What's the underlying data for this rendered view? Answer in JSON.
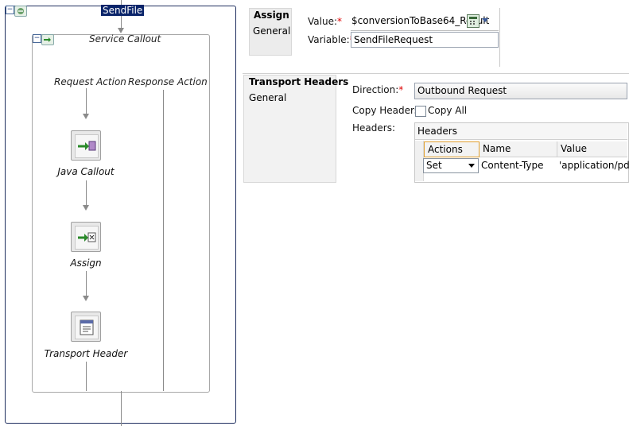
{
  "flow": {
    "title": "SendFile",
    "stage_title": "Service Callout",
    "request_action": "Request Action",
    "response_action": "Response Action",
    "nodes": [
      {
        "label": "Java Callout",
        "icon": "java-callout-icon"
      },
      {
        "label": "Assign",
        "icon": "assign-icon"
      },
      {
        "label": "Transport Header",
        "icon": "transport-header-icon"
      }
    ]
  },
  "assign_panel": {
    "tab_title": "Assign",
    "side_tab": "General",
    "value_label": "Value:",
    "value": "$conversionToBase64_Result",
    "variable_label": "Variable:",
    "variable": "SendFileRequest",
    "required_mark": "*"
  },
  "transport_panel": {
    "tab_title": "Transport Headers",
    "side_tab": "General",
    "direction_label": "Direction:",
    "direction_value": "Outbound Request",
    "copy_headers_label": "Copy Headers:",
    "copy_all_label": "Copy All",
    "copy_all_checked": false,
    "headers_label": "Headers:",
    "table_title": "Headers",
    "columns": [
      "Actions",
      "Name",
      "Value"
    ],
    "rows": [
      {
        "action": "Set",
        "name": "Content-Type",
        "value": "'application/pdf'"
      }
    ],
    "required_mark": "*"
  },
  "colors": {
    "selection": "#0a246a",
    "frame": "#1f2f5f",
    "connector": "#8a8a8a",
    "required": "#dd0000"
  }
}
